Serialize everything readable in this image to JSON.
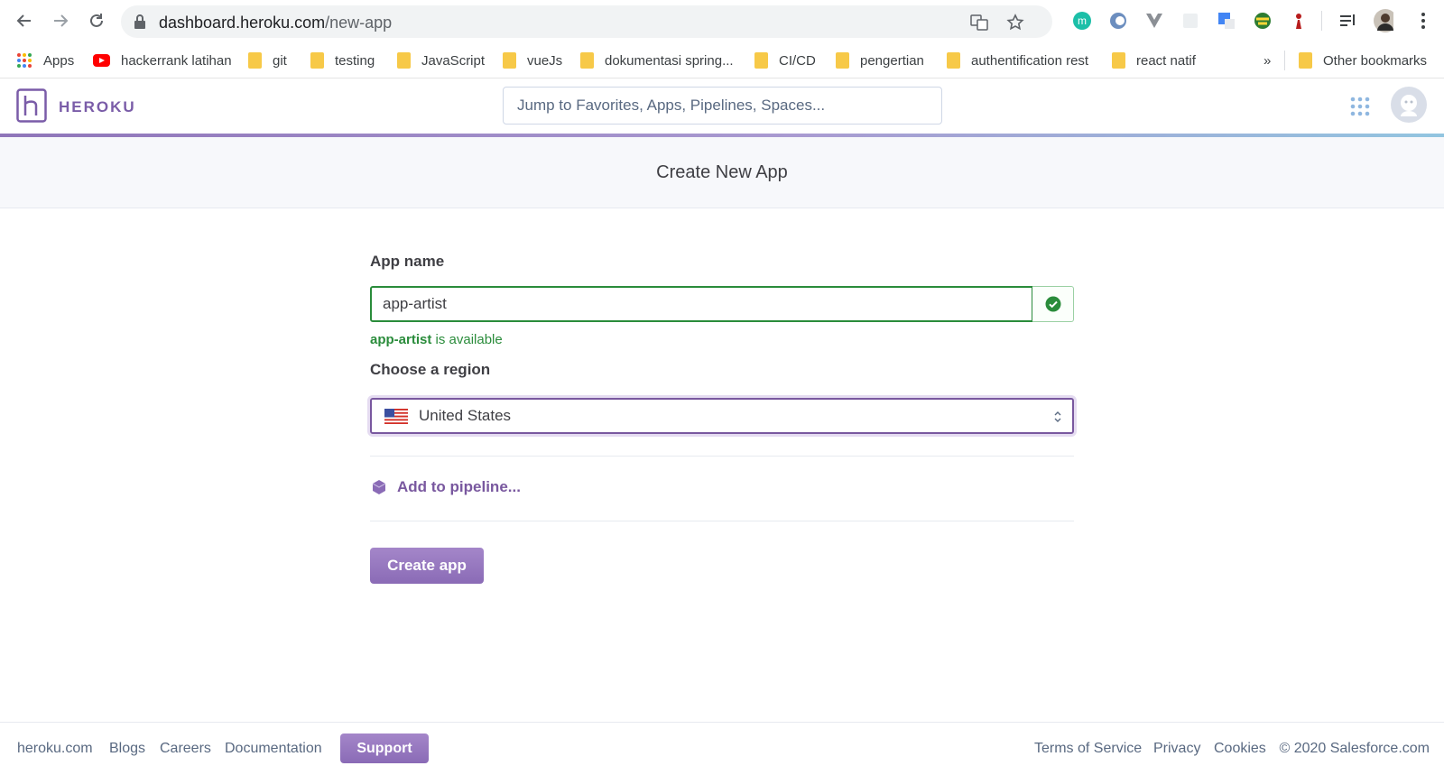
{
  "browser": {
    "url_host": "dashboard.heroku.com",
    "url_path": "/new-app",
    "bookmarks": [
      {
        "label": "Apps",
        "icon": "apps-grid-icon"
      },
      {
        "label": "hackerrank latihan",
        "icon": "youtube-icon"
      },
      {
        "label": "git",
        "icon": "folder-icon"
      },
      {
        "label": "testing",
        "icon": "folder-icon"
      },
      {
        "label": "JavaScript",
        "icon": "folder-icon"
      },
      {
        "label": "vueJs",
        "icon": "folder-icon"
      },
      {
        "label": "dokumentasi spring...",
        "icon": "folder-icon"
      },
      {
        "label": "CI/CD",
        "icon": "folder-icon"
      },
      {
        "label": "pengertian",
        "icon": "folder-icon"
      },
      {
        "label": "authentification rest",
        "icon": "folder-icon"
      },
      {
        "label": "react natif",
        "icon": "folder-icon"
      }
    ],
    "overflow_label": "»",
    "other_bookmarks": "Other bookmarks"
  },
  "header": {
    "brand": "HEROKU",
    "search_placeholder": "Jump to Favorites, Apps, Pipelines, Spaces..."
  },
  "page": {
    "title": "Create New App"
  },
  "form": {
    "app_name_label": "App name",
    "app_name_value": "app-artist",
    "availability_name": "app-artist",
    "availability_text": " is available",
    "region_label": "Choose a region",
    "region_value": "United States",
    "pipeline_label": "Add to pipeline...",
    "create_label": "Create app"
  },
  "footer": {
    "links": [
      "heroku.com",
      "Blogs",
      "Careers",
      "Documentation"
    ],
    "support": "Support",
    "right_links": [
      "Terms of Service",
      "Privacy",
      "Cookies"
    ],
    "copyright": "© 2020 Salesforce.com"
  },
  "colors": {
    "brand_purple": "#79589f",
    "success_green": "#2a8c3b"
  }
}
